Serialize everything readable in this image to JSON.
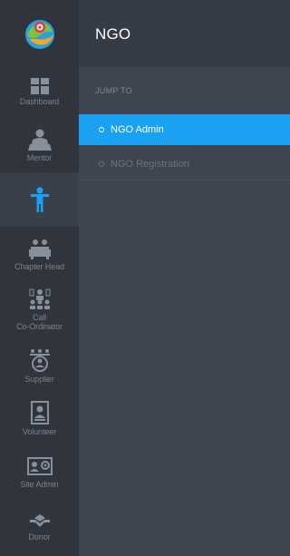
{
  "panel": {
    "title": "NGO",
    "jump_label": "JUMP TO",
    "items": [
      {
        "label": "NGO Admin",
        "active": true
      },
      {
        "label": "NGO Registration",
        "active": false
      }
    ]
  },
  "rail": {
    "items": [
      {
        "label": "Dashboard",
        "icon": "dashboard-icon"
      },
      {
        "label": "Mentor",
        "icon": "mentor-icon"
      },
      {
        "label": "",
        "icon": "person-icon",
        "active": true
      },
      {
        "label": "Chapter Head",
        "icon": "chapter-head-icon"
      },
      {
        "label": "Call\nCo-Ordinator",
        "icon": "call-coordinator-icon"
      },
      {
        "label": "Supplier",
        "icon": "supplier-icon"
      },
      {
        "label": "Volunteer",
        "icon": "volunteer-icon"
      },
      {
        "label": "Site Admin",
        "icon": "site-admin-icon"
      },
      {
        "label": "Donor",
        "icon": "donor-icon"
      }
    ]
  },
  "colors": {
    "accent": "#1ba1f2",
    "rail_bg": "#2f343d",
    "panel_bg": "#3e4450"
  }
}
